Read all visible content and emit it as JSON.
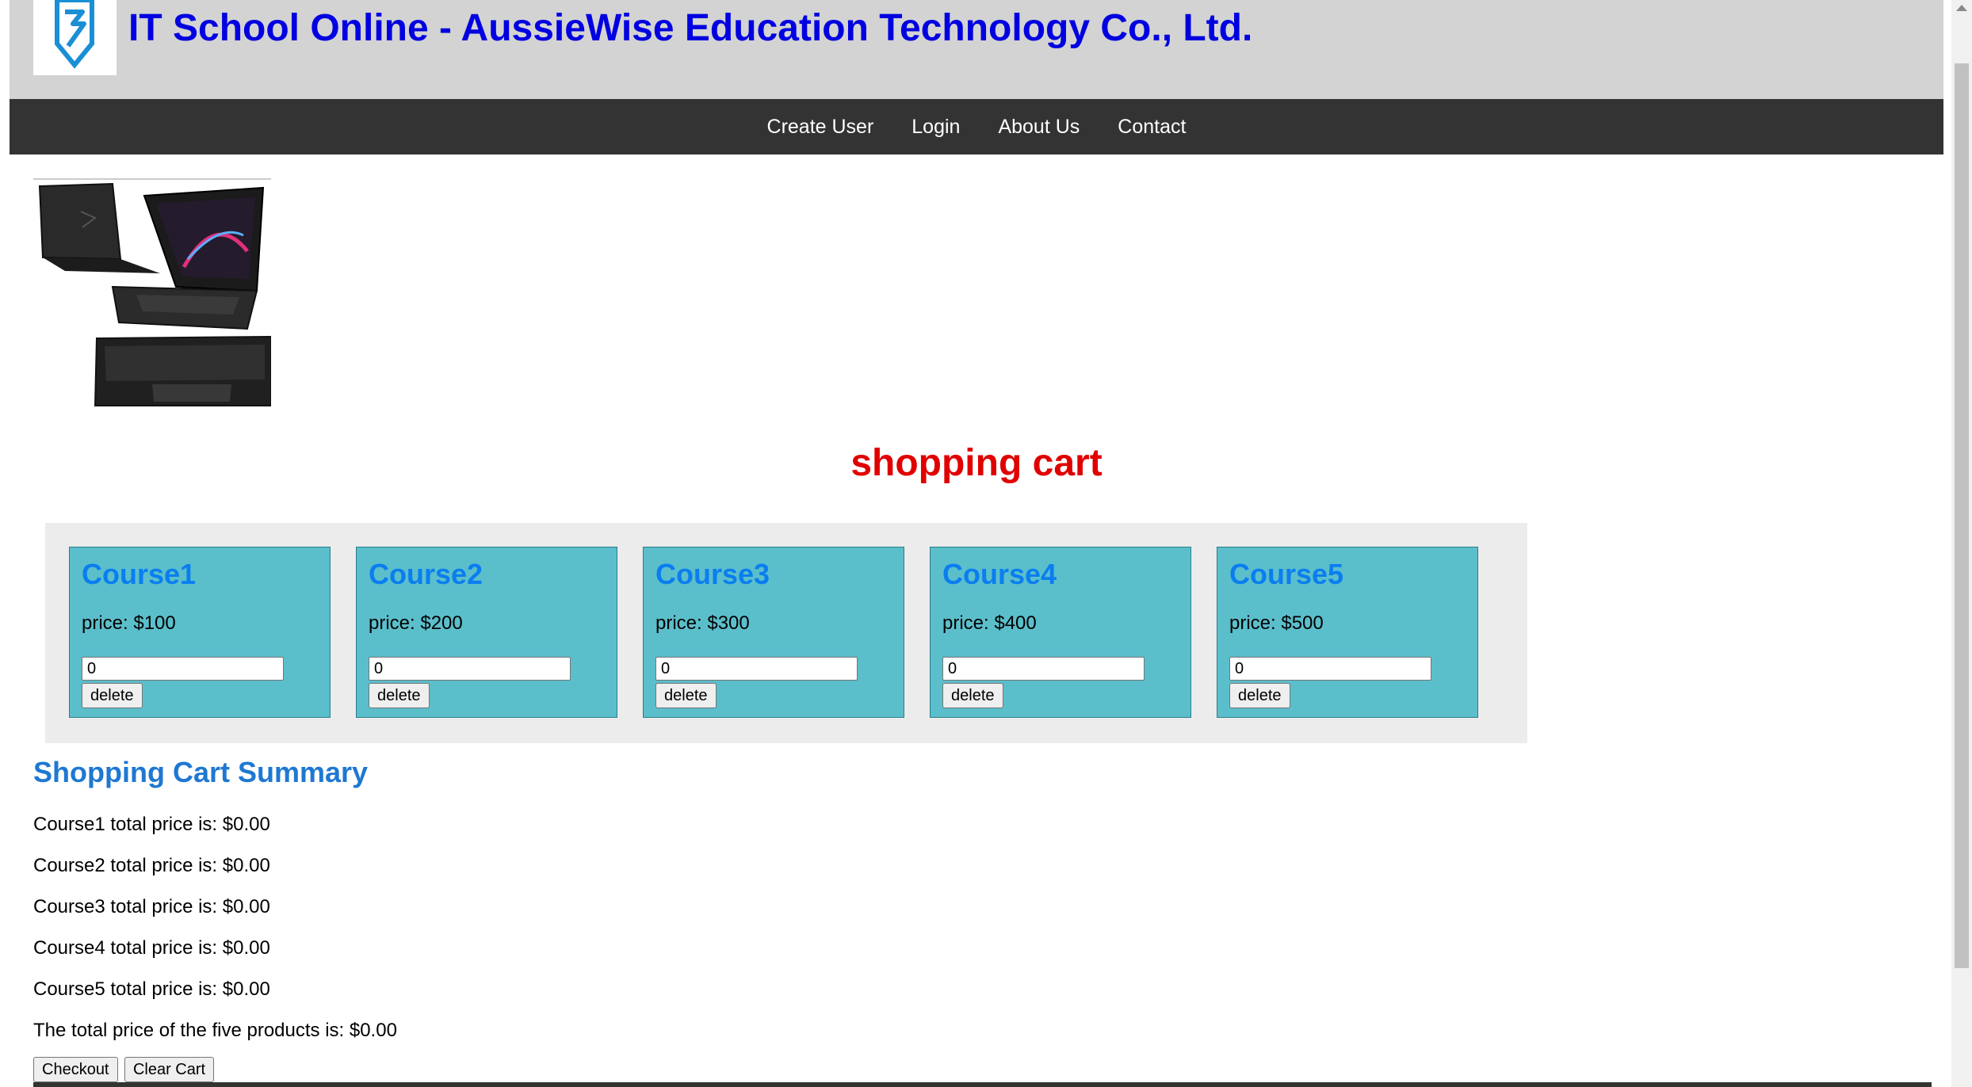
{
  "header": {
    "title": "IT School Online - AussieWise Education Technology Co., Ltd.",
    "logo_icon": "shield-logo-icon"
  },
  "nav": {
    "items": [
      "Create User",
      "Login",
      "About Us",
      "Contact"
    ]
  },
  "hero": {
    "image": "laptop-product-image"
  },
  "cart": {
    "title": "shopping cart",
    "courses": [
      {
        "name": "Course1",
        "price": "price: $100",
        "qty": "0",
        "delete_label": "delete"
      },
      {
        "name": "Course2",
        "price": "price: $200",
        "qty": "0",
        "delete_label": "delete"
      },
      {
        "name": "Course3",
        "price": "price: $300",
        "qty": "0",
        "delete_label": "delete"
      },
      {
        "name": "Course4",
        "price": "price: $400",
        "qty": "0",
        "delete_label": "delete"
      },
      {
        "name": "Course5",
        "price": "price: $500",
        "qty": "0",
        "delete_label": "delete"
      }
    ]
  },
  "summary": {
    "title": "Shopping Cart Summary",
    "lines": [
      "Course1 total price is: $0.00",
      "Course2 total price is: $0.00",
      "Course3 total price is: $0.00",
      "Course4 total price is: $0.00",
      "Course5 total price is: $0.00"
    ],
    "total": "The total price of the five products is: $0.00",
    "checkout_label": "Checkout",
    "clear_label": "Clear Cart"
  },
  "colors": {
    "header_bg": "#d3d3d3",
    "title_blue": "#0000e0",
    "nav_bg": "#333333",
    "cart_title_red": "#e00000",
    "card_bg": "#5bbecb",
    "course_title_blue": "#0a7ef0",
    "summary_title_blue": "#1e78d2"
  }
}
